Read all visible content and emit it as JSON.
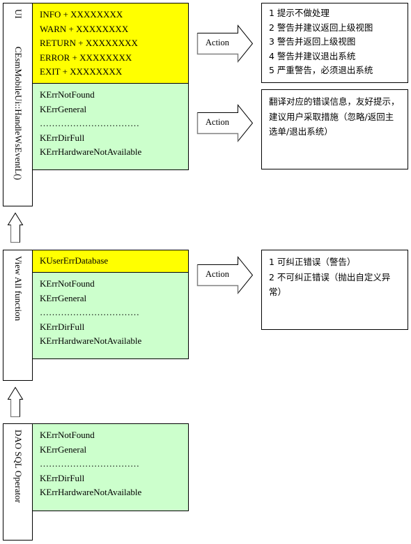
{
  "layers": [
    {
      "id": "ui",
      "label": "UI        CEsmMobileUi::HandleWsEventL()",
      "label_parts": [
        "UI",
        "CEsmMobileUi::HandleWsEventL()"
      ],
      "yellow_items": [
        "INFO + XXXXXXXX",
        "WARN + XXXXXXXX",
        "RETURN + XXXXXXXX",
        "ERROR + XXXXXXXX",
        "EXIT + XXXXXXXX"
      ],
      "green_items": [
        "KErrNotFound",
        "KErrGeneral",
        "……………………………",
        "KErrDirFull",
        "KErrHardwareNotAvailable"
      ],
      "actions": [
        {
          "arrow_label": "Action",
          "note_lines": [
            "1 提示不做处理",
            "2 警告并建议返回上级视图",
            "3 警告并返回上级视图",
            "4 警告并建议退出系统",
            "5 严重警告，必须退出系统"
          ]
        },
        {
          "arrow_label": "Action",
          "note_text": "翻译对应的错误信息，友好提示，建议用户采取措施（忽略/返回主选单/退出系统）"
        }
      ]
    },
    {
      "id": "view",
      "label": "View All function",
      "yellow_items": [
        "KUserErrDatabase"
      ],
      "green_items": [
        "KErrNotFound",
        "KErrGeneral",
        "……………………………",
        "KErrDirFull",
        "KErrHardwareNotAvailable"
      ],
      "actions": [
        {
          "arrow_label": "Action",
          "note_text": "1 可纠正错误（警告）\n2 不可纠正错误（抛出自定义异常）"
        }
      ]
    },
    {
      "id": "dao",
      "label": "DAO SQL Operator",
      "green_items": [
        "KErrNotFound",
        "KErrGeneral",
        "……………………………",
        "KErrDirFull",
        "KErrHardwareNotAvailable"
      ]
    }
  ],
  "colors": {
    "warning_section": "#ffff00",
    "error_section": "#ccffcc",
    "border": "#000000"
  }
}
